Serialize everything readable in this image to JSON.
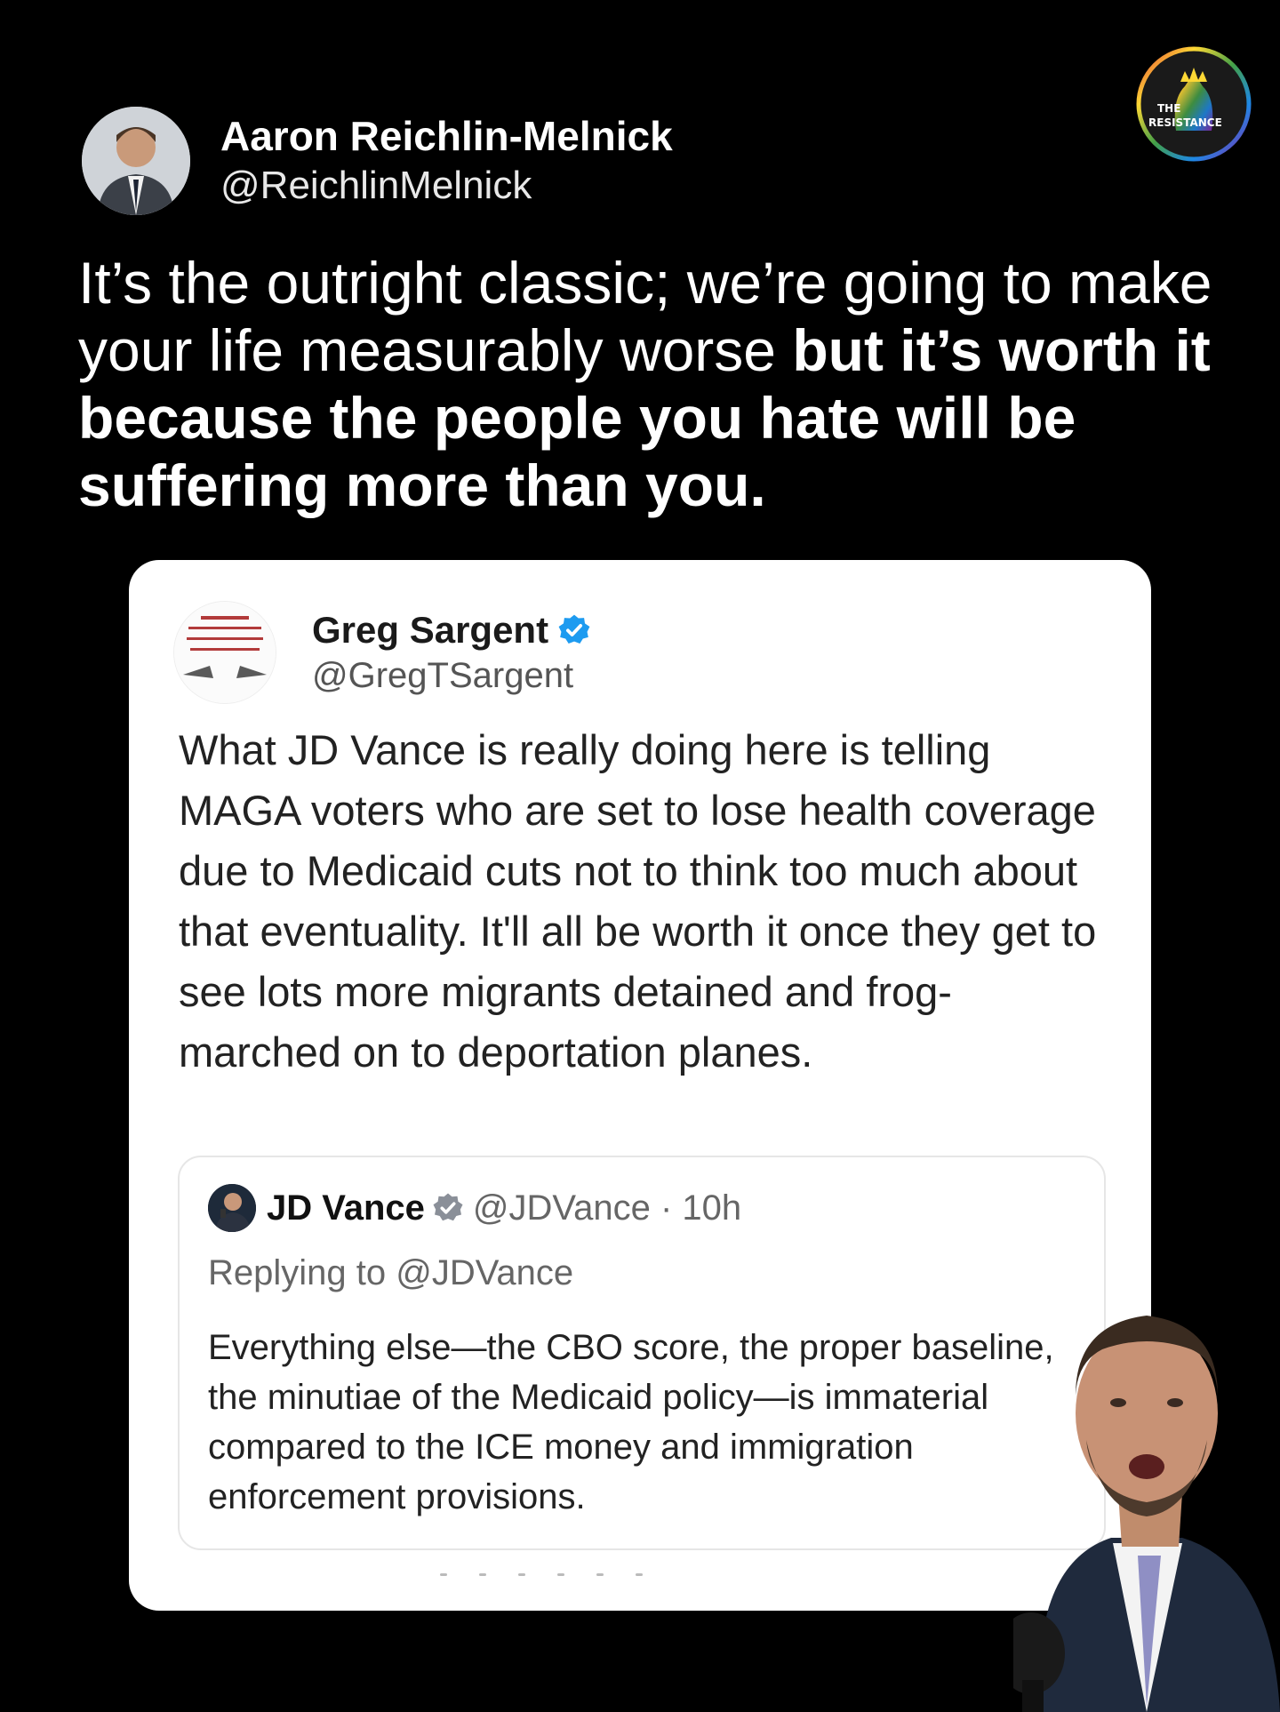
{
  "logo": {
    "label_line1": "THE",
    "label_line2": "RESISTANCE"
  },
  "outer_tweet": {
    "author_name": "Aaron Reichlin-Melnick",
    "author_handle": "@ReichlinMelnick",
    "text_normal": "It’s the outright classic; we’re going to make your life measurably worse ",
    "text_bold": "but it’s worth it because the people you hate will be suffering more than you."
  },
  "quoted_tweet": {
    "author_name": "Greg Sargent",
    "author_handle": "@GregTSargent",
    "text": "What JD Vance is really doing here is telling MAGA voters who are set to lose health coverage due to Medicaid cuts not to think too much about that eventuality. It'll all be worth it once they get to see lots more migrants detained and frog-marched on to deportation planes."
  },
  "nested_tweet": {
    "author_name": "JD Vance",
    "meta": "@JDVance · 10h",
    "reply_line": "Replying to @JDVance",
    "text": "Everything else—the CBO score, the proper baseline, the minutiae of the Medicaid policy—is immaterial compared to the ICE money and immigration enforcement provisions."
  },
  "colors": {
    "background": "#000000",
    "card": "#ffffff",
    "verified_blue": "#1d9bf0",
    "verified_gray": "#8a8f98"
  },
  "icons": {
    "verified_blue": "verified-badge-icon",
    "verified_gray": "gray-checkmark-badge-icon"
  }
}
